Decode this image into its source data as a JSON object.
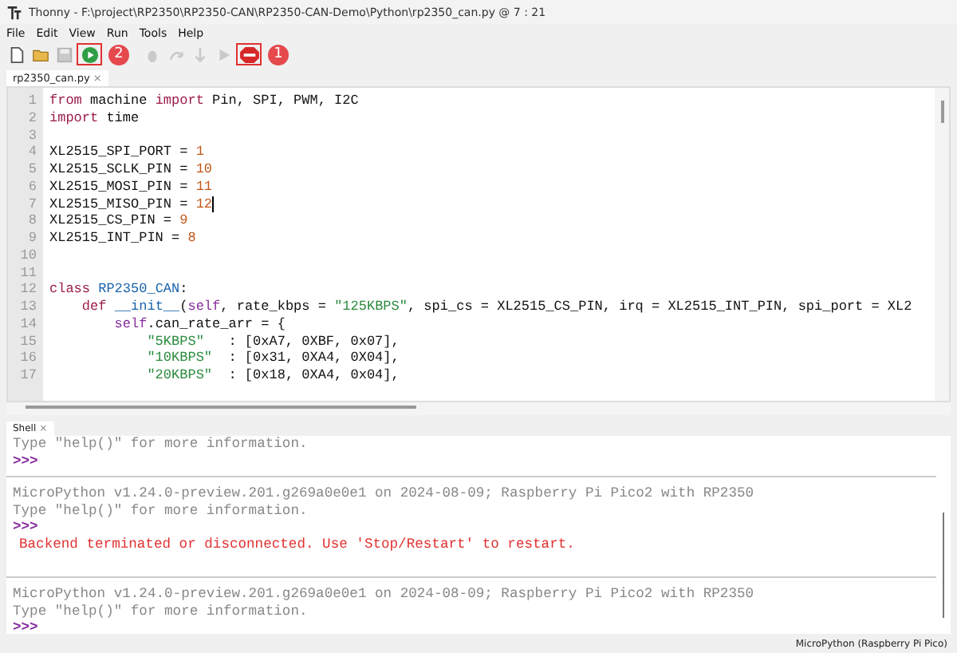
{
  "window": {
    "title": "Thonny  -  F:\\project\\RP2350\\RP2350-CAN\\RP2350-CAN-Demo\\Python\\rp2350_can.py  @  7 : 21"
  },
  "menu": [
    "File",
    "Edit",
    "View",
    "Run",
    "Tools",
    "Help"
  ],
  "toolbar": [
    {
      "kind": "new",
      "disabled": false,
      "highlighted": false
    },
    {
      "kind": "open",
      "disabled": false,
      "highlighted": false
    },
    {
      "kind": "save",
      "disabled": true,
      "highlighted": false
    },
    {
      "kind": "run",
      "disabled": false,
      "highlighted": true,
      "marker": "2"
    },
    {
      "kind": "debug",
      "disabled": true,
      "highlighted": false
    },
    {
      "kind": "step-over",
      "disabled": true,
      "highlighted": false
    },
    {
      "kind": "step-into",
      "disabled": true,
      "highlighted": false
    },
    {
      "kind": "resume",
      "disabled": true,
      "highlighted": false
    },
    {
      "kind": "stop",
      "disabled": false,
      "highlighted": true,
      "marker": "1"
    }
  ],
  "editor": {
    "tab": {
      "label": "rp2350_can.py",
      "close": "×"
    },
    "lines": [
      {
        "number": "1",
        "cursor": false,
        "tokens": [
          {
            "kind": "kw",
            "text": "from"
          },
          {
            "kind": "plain",
            "text": " machine "
          },
          {
            "kind": "kw",
            "text": "import"
          },
          {
            "kind": "plain",
            "text": " Pin, SPI, PWM, I2C"
          }
        ]
      },
      {
        "number": "2",
        "cursor": false,
        "tokens": [
          {
            "kind": "kw",
            "text": "import"
          },
          {
            "kind": "plain",
            "text": " time"
          }
        ]
      },
      {
        "number": "3",
        "cursor": false
      },
      {
        "number": "4",
        "cursor": false,
        "tokens": [
          {
            "kind": "plain",
            "text": "XL2515_SPI_PORT = "
          },
          {
            "kind": "num",
            "text": "1"
          }
        ]
      },
      {
        "number": "5",
        "cursor": false,
        "tokens": [
          {
            "kind": "plain",
            "text": "XL2515_SCLK_PIN = "
          },
          {
            "kind": "num",
            "text": "10"
          }
        ]
      },
      {
        "number": "6",
        "cursor": false,
        "tokens": [
          {
            "kind": "plain",
            "text": "XL2515_MOSI_PIN = "
          },
          {
            "kind": "num",
            "text": "11"
          }
        ]
      },
      {
        "number": "7",
        "cursor": true,
        "tokens": [
          {
            "kind": "plain",
            "text": "XL2515_MISO_PIN = "
          },
          {
            "kind": "num",
            "text": "12"
          }
        ]
      },
      {
        "number": "8",
        "cursor": false,
        "tokens": [
          {
            "kind": "plain",
            "text": "XL2515_CS_PIN = "
          },
          {
            "kind": "num",
            "text": "9"
          }
        ]
      },
      {
        "number": "9",
        "cursor": false,
        "tokens": [
          {
            "kind": "plain",
            "text": "XL2515_INT_PIN = "
          },
          {
            "kind": "num",
            "text": "8"
          }
        ]
      },
      {
        "number": "10",
        "cursor": false
      },
      {
        "number": "11",
        "cursor": false
      },
      {
        "number": "12",
        "cursor": false,
        "tokens": [
          {
            "kind": "kw",
            "text": "class "
          },
          {
            "kind": "name",
            "text": "RP2350_CAN"
          },
          {
            "kind": "plain",
            "text": ":"
          }
        ]
      },
      {
        "number": "13",
        "cursor": false,
        "tokens": [
          {
            "kind": "kw",
            "text": "    def "
          },
          {
            "kind": "name",
            "text": "__init__"
          },
          {
            "kind": "plain",
            "text": "("
          },
          {
            "kind": "self",
            "text": "self"
          },
          {
            "kind": "plain",
            "text": ", rate_kbps = "
          },
          {
            "kind": "str",
            "text": "\"125KBPS\""
          },
          {
            "kind": "plain",
            "text": ", spi_cs = XL2515_CS_PIN, irq = XL2515_INT_PIN, spi_port = XL2"
          }
        ]
      },
      {
        "number": "14",
        "cursor": false,
        "tokens": [
          {
            "kind": "self",
            "text": "        self"
          },
          {
            "kind": "plain",
            "text": ".can_rate_arr = {"
          }
        ]
      },
      {
        "number": "15",
        "cursor": false,
        "tokens": [
          {
            "kind": "str",
            "text": "            \"5KBPS\""
          },
          {
            "kind": "plain",
            "text": "   : [0xA7, 0XBF, 0x07],"
          }
        ]
      },
      {
        "number": "16",
        "cursor": false,
        "tokens": [
          {
            "kind": "str",
            "text": "            \"10KBPS\""
          },
          {
            "kind": "plain",
            "text": "  : [0x31, 0XA4, 0X04],"
          }
        ]
      },
      {
        "number": "17",
        "cursor": false,
        "tokens": [
          {
            "kind": "str",
            "text": "            \"20KBPS\""
          },
          {
            "kind": "plain",
            "text": "  : [0x18, 0XA4, 0x04],"
          }
        ]
      }
    ]
  },
  "shell": {
    "tab": {
      "label": "Shell",
      "close": "×"
    },
    "lines": [
      {
        "kind": "output",
        "text": "Type \"help()\" for more information."
      },
      {
        "kind": "prompt",
        "text": ">>>"
      },
      {
        "kind": "separator"
      },
      {
        "kind": "output",
        "text": "MicroPython v1.24.0-preview.201.g269a0e0e1 on 2024-08-09; Raspberry Pi Pico2 with RP2350"
      },
      {
        "kind": "output",
        "text": "Type \"help()\" for more information."
      },
      {
        "kind": "prompt",
        "text": ">>>"
      },
      {
        "kind": "error",
        "text": "Backend terminated or disconnected. Use 'Stop/Restart' to restart."
      },
      {
        "kind": "blank"
      },
      {
        "kind": "separator"
      },
      {
        "kind": "output",
        "text": "MicroPython v1.24.0-preview.201.g269a0e0e1 on 2024-08-09; Raspberry Pi Pico2 with RP2350"
      },
      {
        "kind": "output",
        "text": "Type \"help()\" for more information."
      },
      {
        "kind": "prompt",
        "text": ">>>"
      }
    ]
  },
  "status_bar": {
    "interpreter": "MicroPython (Raspberry Pi Pico)"
  }
}
